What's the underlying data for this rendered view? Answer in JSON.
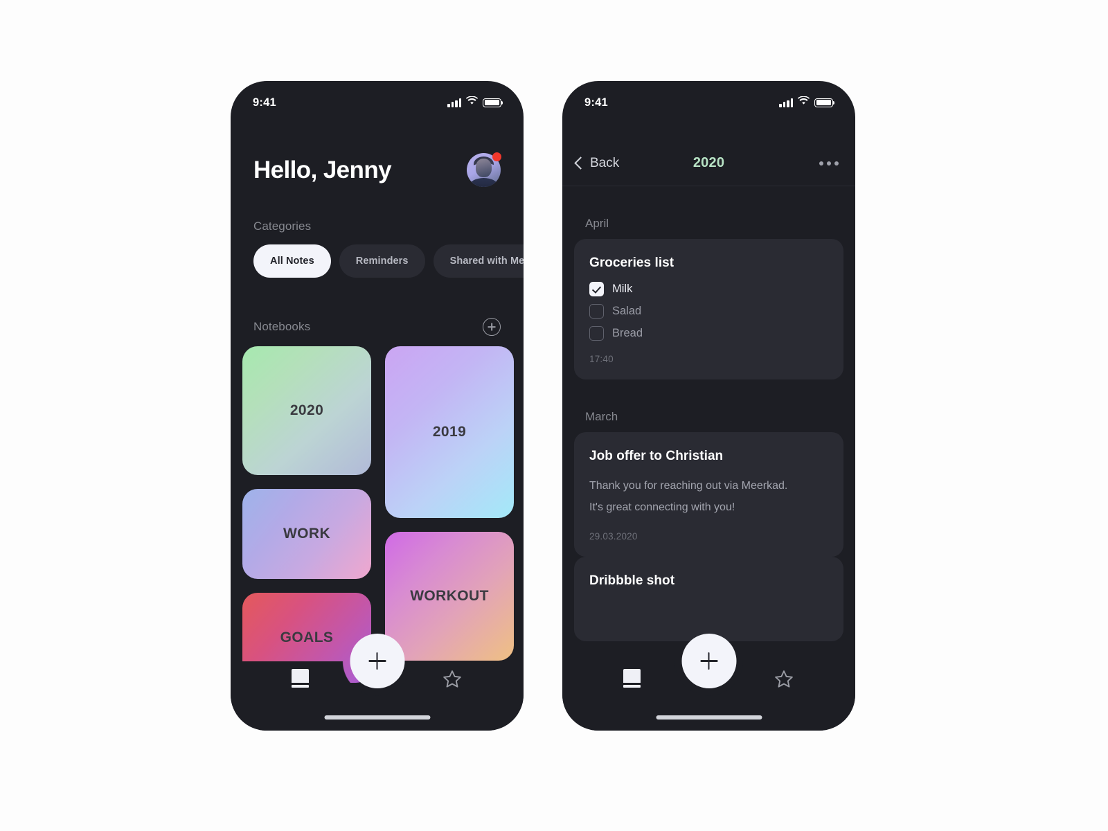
{
  "screens": {
    "home": {
      "status": {
        "time": "9:41",
        "signal_icon": "cellular-signal-icon",
        "wifi_icon": "wifi-icon",
        "battery_icon": "battery-icon"
      },
      "greeting": "Hello, Jenny",
      "avatar": {
        "name": "avatar",
        "badge": "notification-dot",
        "badge_color": "#f2382c"
      },
      "categories_label": "Categories",
      "pills": [
        {
          "label": "All Notes",
          "active": true
        },
        {
          "label": "Reminders",
          "active": false
        },
        {
          "label": "Shared with Me",
          "active": false
        }
      ],
      "notebooks_label": "Notebooks",
      "add_notebook_icon": "plus-circle-icon",
      "notebooks": [
        {
          "label": "2020",
          "gradient": "linear-gradient(135deg, #a4e8ae 0%, #b6dfc0 35%, #bdd2d8 70%, #b2bad6 100%)"
        },
        {
          "label": "2019",
          "gradient": "linear-gradient(135deg, #c9a7f2 0%, #c2b4f3 30%, #bdd0f6 60%, #a6e8f7 100%)"
        },
        {
          "label": "WORK",
          "gradient": "linear-gradient(128deg, #9fb2e8 0%, #b4a9e6 35%, #c9a9e0 65%, #efa8cf 100%)"
        },
        {
          "label": "WORKOUT",
          "gradient": "linear-gradient(135deg, #d濃 0%, #d濃 100%)"
        },
        {
          "label": "GOALS",
          "gradient": "linear-gradient(130deg, #e45a5a 0%, #d9527f 35%, #c358ab 70%, #a95fd4 100%)"
        }
      ],
      "tabbar": {
        "book_icon": "notebook-icon",
        "star_icon": "star-icon",
        "fab_icon": "plus-icon"
      }
    },
    "detail": {
      "status": {
        "time": "9:41",
        "signal_icon": "cellular-signal-icon",
        "wifi_icon": "wifi-icon",
        "battery_icon": "battery-icon"
      },
      "back_label": "Back",
      "back_icon": "chevron-left-icon",
      "title": "2020",
      "title_color": "#b7e2c4",
      "more_icon": "more-options-icon",
      "sections": [
        {
          "month": "April",
          "notes": [
            {
              "type": "checklist",
              "title": "Groceries list",
              "items": [
                {
                  "label": "Milk",
                  "checked": true
                },
                {
                  "label": "Salad",
                  "checked": false
                },
                {
                  "label": "Bread",
                  "checked": false
                }
              ],
              "time": "17:40"
            }
          ]
        },
        {
          "month": "March",
          "notes": [
            {
              "type": "text",
              "title": "Job offer to Christian",
              "body_line1": "Thank you for reaching out via Meerkad.",
              "body_line2": "It's great connecting with you!",
              "time": "29.03.2020"
            },
            {
              "type": "text",
              "title": "Dribbble shot",
              "body_line1": "",
              "body_line2": "",
              "time": ""
            }
          ]
        }
      ],
      "tabbar": {
        "book_icon": "notebook-icon",
        "star_icon": "star-icon",
        "fab_icon": "plus-icon"
      }
    }
  },
  "notebook_gradients": {
    "n2020": "linear-gradient(138deg, #a6e9af 0%, #b4e0ba 28%, #bcd4d4 62%, #b1bad8 100%)",
    "n2019": "linear-gradient(138deg, #cba5f3 0%, #c3b5f4 32%, #bcd2f7 66%, #a3e9f8 100%)",
    "work": "linear-gradient(128deg, #9eb3ea 0%, #b3aae7 32%, #c8a9e1 62%, #f0a7ce 100%)",
    "workout": "linear-gradient(136deg, #d濃0 0%, #d濃0 100%)",
    "goals": "linear-gradient(130deg, #e4595b 0%, #d85280 34%, #c257ac 68%, #a85ed6 100%)"
  }
}
